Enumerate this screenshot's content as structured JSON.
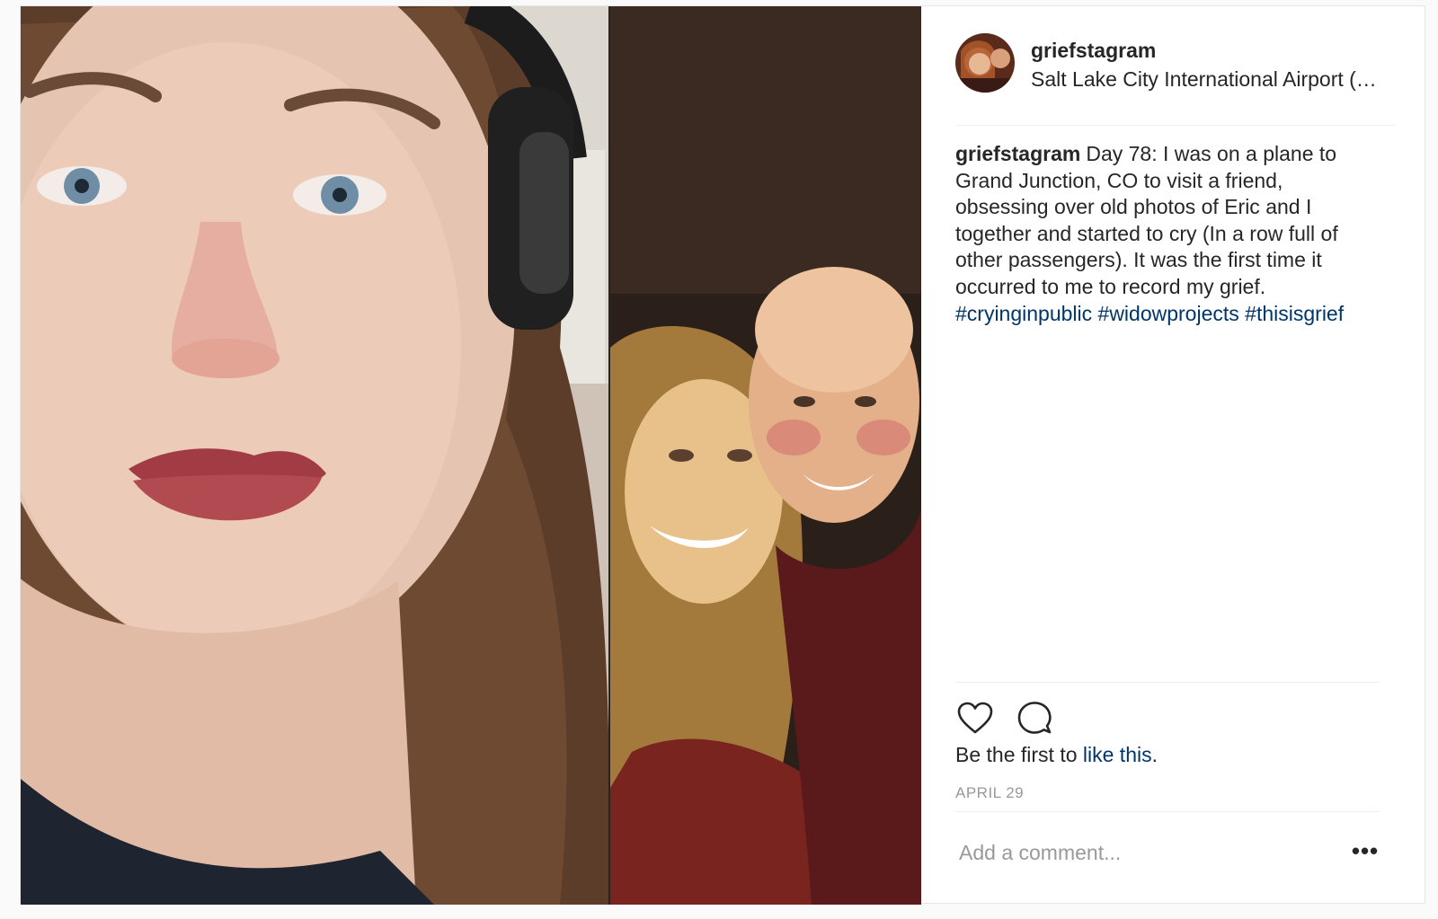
{
  "post": {
    "username": "griefstagram",
    "location": "Salt Lake City International Airport (SLC)",
    "caption": {
      "username": "griefstagram",
      "text": "Day 78: I was on a plane to Grand Junction, CO to visit a friend, obsessing over old photos of Eric and I together and started to cry (In a row full of other passengers). It was the first time it occurred to me to record my grief.",
      "hashtags": [
        "#cryinginpublic",
        "#widowprojects",
        "#thisisgrief"
      ]
    },
    "likes": {
      "prefix": "Be the first to ",
      "link": "like this",
      "suffix": "."
    },
    "date": "APRIL 29",
    "comment": {
      "placeholder": "Add a comment..."
    },
    "more_label": "•••",
    "icons": {
      "like": "heart-icon",
      "comment": "speech-bubble-icon",
      "more": "ellipsis-icon"
    },
    "colors": {
      "link": "#003569",
      "text": "#262626",
      "muted": "#999999",
      "divider": "#efefef"
    }
  }
}
